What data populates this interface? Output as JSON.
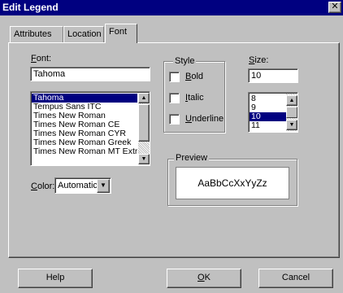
{
  "window": {
    "title": "Edit Legend",
    "close_icon": "close-icon"
  },
  "tabs": [
    {
      "label": "Attributes",
      "active": false
    },
    {
      "label": "Location",
      "active": false
    },
    {
      "label": "Font",
      "active": true
    }
  ],
  "font": {
    "label": "Font:",
    "value": "Tahoma",
    "list": [
      {
        "name": "Tahoma",
        "selected": true
      },
      {
        "name": "Tempus Sans ITC",
        "selected": false
      },
      {
        "name": "Times New Roman",
        "selected": false
      },
      {
        "name": "Times New Roman CE",
        "selected": false
      },
      {
        "name": "Times New Roman CYR",
        "selected": false
      },
      {
        "name": "Times New Roman Greek",
        "selected": false
      },
      {
        "name": "Times New Roman MT Extr",
        "selected": false
      }
    ]
  },
  "style": {
    "title": "Style",
    "options": [
      {
        "label": "Bold",
        "checked": false
      },
      {
        "label": "Italic",
        "checked": false
      },
      {
        "label": "Underline",
        "checked": false
      }
    ]
  },
  "size": {
    "label": "Size:",
    "value": "10",
    "list": [
      {
        "value": "8",
        "selected": false
      },
      {
        "value": "9",
        "selected": false
      },
      {
        "value": "10",
        "selected": true
      },
      {
        "value": "11",
        "selected": false
      }
    ]
  },
  "color": {
    "label": "Color:",
    "value": "Automatic"
  },
  "preview": {
    "title": "Preview",
    "sample": "AaBbCcXxYyZz"
  },
  "buttons": {
    "help": "Help",
    "ok": "OK",
    "cancel": "Cancel"
  },
  "colors": {
    "titlebar": "#000080",
    "face": "#c0c0c0",
    "selection": "#000080"
  }
}
